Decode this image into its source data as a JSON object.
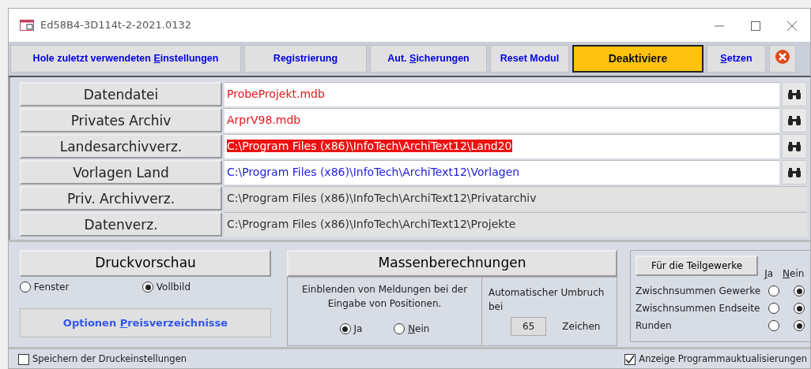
{
  "window": {
    "title": "Ed58B4-3D114t-2-2021.0132"
  },
  "toolbar": [
    {
      "kind": "button",
      "label": {
        "before": "Hole zuletzt verwendeten ",
        "key": "E",
        "after": "instellungen"
      }
    },
    {
      "kind": "button",
      "label": {
        "before": "Registrierung"
      }
    },
    {
      "kind": "button",
      "label": {
        "before": "Aut. ",
        "key": "S",
        "after": "icherungen"
      }
    },
    {
      "kind": "button",
      "label": {
        "before": "Reset Modul"
      }
    },
    {
      "kind": "warning",
      "label": {
        "before": "Deaktiviere"
      }
    },
    {
      "kind": "button",
      "label": {
        "key": "S",
        "after": "etzen"
      }
    },
    {
      "kind": "close"
    }
  ],
  "paths": [
    {
      "label": "Datendatei",
      "value": "ProbeProjekt.mdb",
      "editable": true,
      "color": "#e8141b",
      "highlighted": false
    },
    {
      "label": "Privates Archiv",
      "value": "ArprV98.mdb",
      "editable": true,
      "color": "#e8141b",
      "highlighted": false
    },
    {
      "label": "Landesarchivverz.",
      "value": "C:\\Program Files (x86)\\InfoTech\\ArchiText12\\Land20",
      "editable": true,
      "color": "#ffffff",
      "highlighted": true
    },
    {
      "label": "Vorlagen Land",
      "value": "C:\\Program Files (x86)\\InfoTech\\ArchiText12\\Vorlagen",
      "editable": true,
      "color": "#2020e0",
      "highlighted": false
    },
    {
      "label": "Priv. Archivverz.",
      "value": "C:\\Program Files (x86)\\InfoTech\\ArchiText12\\Privatarchiv",
      "editable": false,
      "color": "#333333",
      "highlighted": false
    },
    {
      "label": "Datenverz.",
      "value": "C:\\Program Files (x86)\\InfoTech\\ArchiText12\\Projekte",
      "editable": false,
      "color": "#333333",
      "highlighted": false
    }
  ],
  "print_preview": {
    "title": "Druckvorschau",
    "options": [
      {
        "label": "Fenster",
        "selected": false
      },
      {
        "label": "Vollbild",
        "selected": true
      }
    ],
    "price_button": {
      "before": "Optionen ",
      "key": "P",
      "after": "reisverzeichnisse"
    }
  },
  "mass": {
    "title": "Massenberechnungen",
    "messages_label": "Einblenden von Meldungen bei der Eingabe von Positionen.",
    "messages_options": [
      {
        "label": {
          "key": "J",
          "after": "a"
        },
        "selected": true
      },
      {
        "label": {
          "key": "N",
          "after": "ein"
        },
        "selected": false
      }
    ],
    "wrap_label": "Automatischer Umbruch bei",
    "wrap_value": "65",
    "wrap_unit": "Zeichen"
  },
  "subtrades": {
    "button": "Für die Teilgewerke",
    "columns": [
      {
        "key": "J",
        "after": "a"
      },
      {
        "key": "N",
        "after": "ein"
      }
    ],
    "rows": [
      {
        "label": "Zwischnsummen Gewerke",
        "yes": false
      },
      {
        "label": "Zwischnsummen Endseite",
        "yes": false
      },
      {
        "label": "Runden",
        "yes": false
      }
    ]
  },
  "status": [
    {
      "label": "Speichern der Druckeinstellungen",
      "checked": false
    },
    {
      "label": "Anzeige Programmauktualisierungen",
      "checked": true
    }
  ]
}
